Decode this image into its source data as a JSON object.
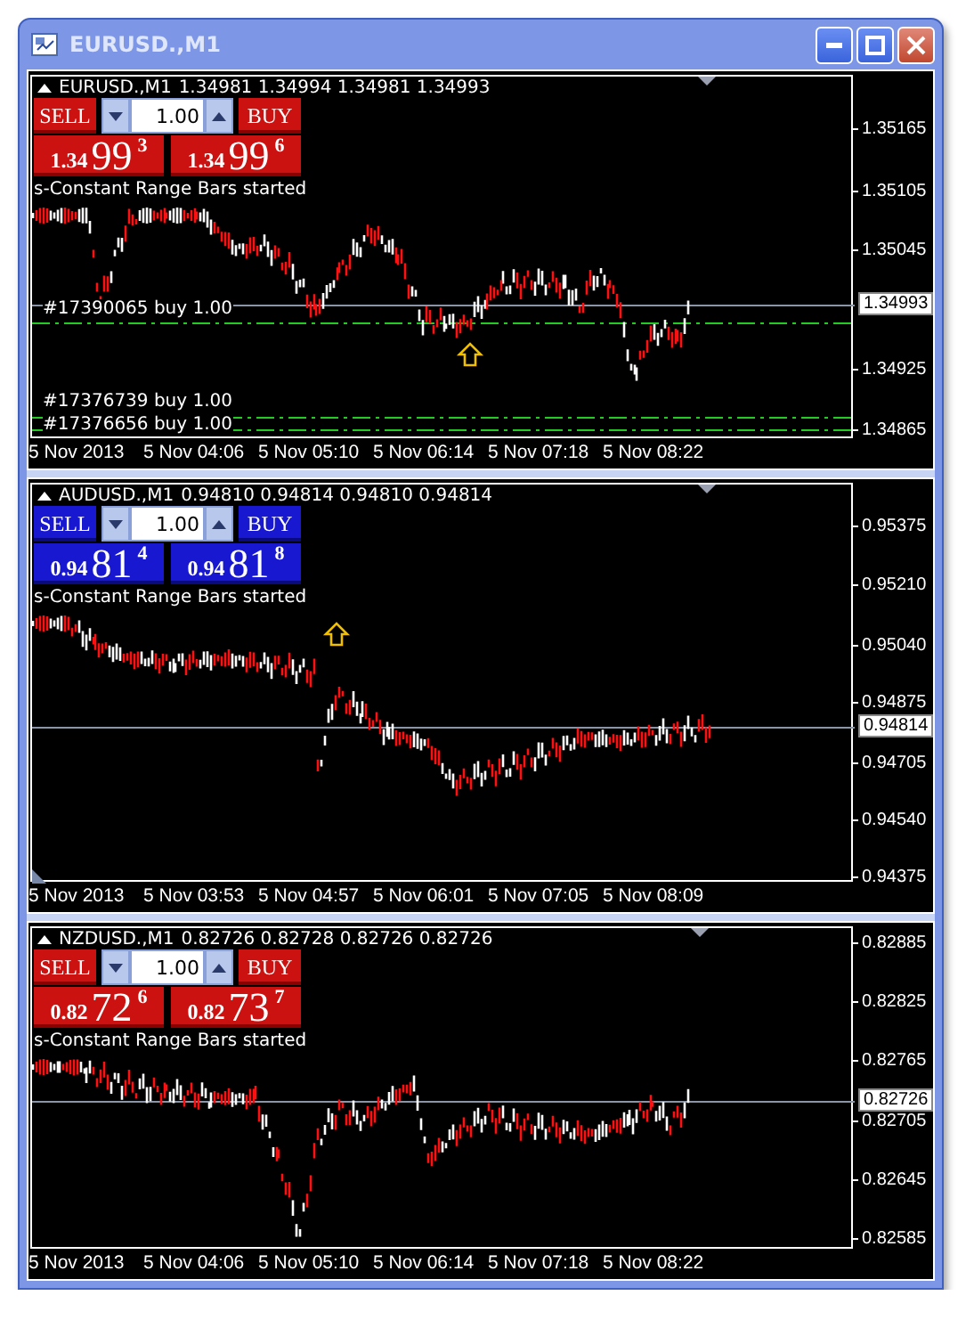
{
  "window": {
    "title": "EURUSD.,M1"
  },
  "charts": [
    {
      "symbol": "EURUSD.,M1",
      "ohlc": "1.34981 1.34994 1.34981 1.34993",
      "panel": {
        "color": "#cc1111",
        "sell_label": "SELL",
        "buy_label": "BUY",
        "lot": "1.00",
        "sell_price": {
          "prefix": "1.34",
          "pips": "99",
          "fraction": "3"
        },
        "buy_price": {
          "prefix": "1.34",
          "pips": "99",
          "fraction": "6"
        }
      },
      "message": "s-Constant Range Bars started",
      "orders": [
        {
          "label": "#17390065 buy 1.00"
        },
        {
          "label": "#17376739 buy 1.00"
        },
        {
          "label": "#17376656 buy 1.00"
        }
      ],
      "price_axis": [
        "1.35165",
        "1.35105",
        "1.35045",
        "1.34925",
        "1.34865"
      ],
      "current_price": "1.34993",
      "time_axis": [
        "5 Nov 2013",
        "5 Nov 04:06",
        "5 Nov 05:10",
        "5 Nov 06:14",
        "5 Nov 07:18",
        "5 Nov 08:22"
      ]
    },
    {
      "symbol": "AUDUSD.,M1",
      "ohlc": "0.94810 0.94814 0.94810 0.94814",
      "panel": {
        "color": "#1818d0",
        "sell_label": "SELL",
        "buy_label": "BUY",
        "lot": "1.00",
        "sell_price": {
          "prefix": "0.94",
          "pips": "81",
          "fraction": "4"
        },
        "buy_price": {
          "prefix": "0.94",
          "pips": "81",
          "fraction": "8"
        }
      },
      "message": "s-Constant Range Bars started",
      "price_axis": [
        "0.95375",
        "0.95210",
        "0.95040",
        "0.94875",
        "0.94705",
        "0.94540",
        "0.94375"
      ],
      "current_price": "0.94814",
      "time_axis": [
        "5 Nov 2013",
        "5 Nov 03:53",
        "5 Nov 04:57",
        "5 Nov 06:01",
        "5 Nov 07:05",
        "5 Nov 08:09"
      ]
    },
    {
      "symbol": "NZDUSD.,M1",
      "ohlc": "0.82726 0.82728 0.82726 0.82726",
      "panel": {
        "color": "#cc1111",
        "sell_label": "SELL",
        "buy_label": "BUY",
        "lot": "1.00",
        "sell_price": {
          "prefix": "0.82",
          "pips": "72",
          "fraction": "6"
        },
        "buy_price": {
          "prefix": "0.82",
          "pips": "73",
          "fraction": "7"
        }
      },
      "message": "s-Constant Range Bars started",
      "price_axis": [
        "0.82885",
        "0.82825",
        "0.82765",
        "0.82705",
        "0.82645",
        "0.82585"
      ],
      "current_price": "0.82726",
      "time_axis": [
        "5 Nov 2013",
        "5 Nov 04:06",
        "5 Nov 05:10",
        "5 Nov 06:14",
        "5 Nov 07:18",
        "5 Nov 08:22"
      ]
    }
  ]
}
